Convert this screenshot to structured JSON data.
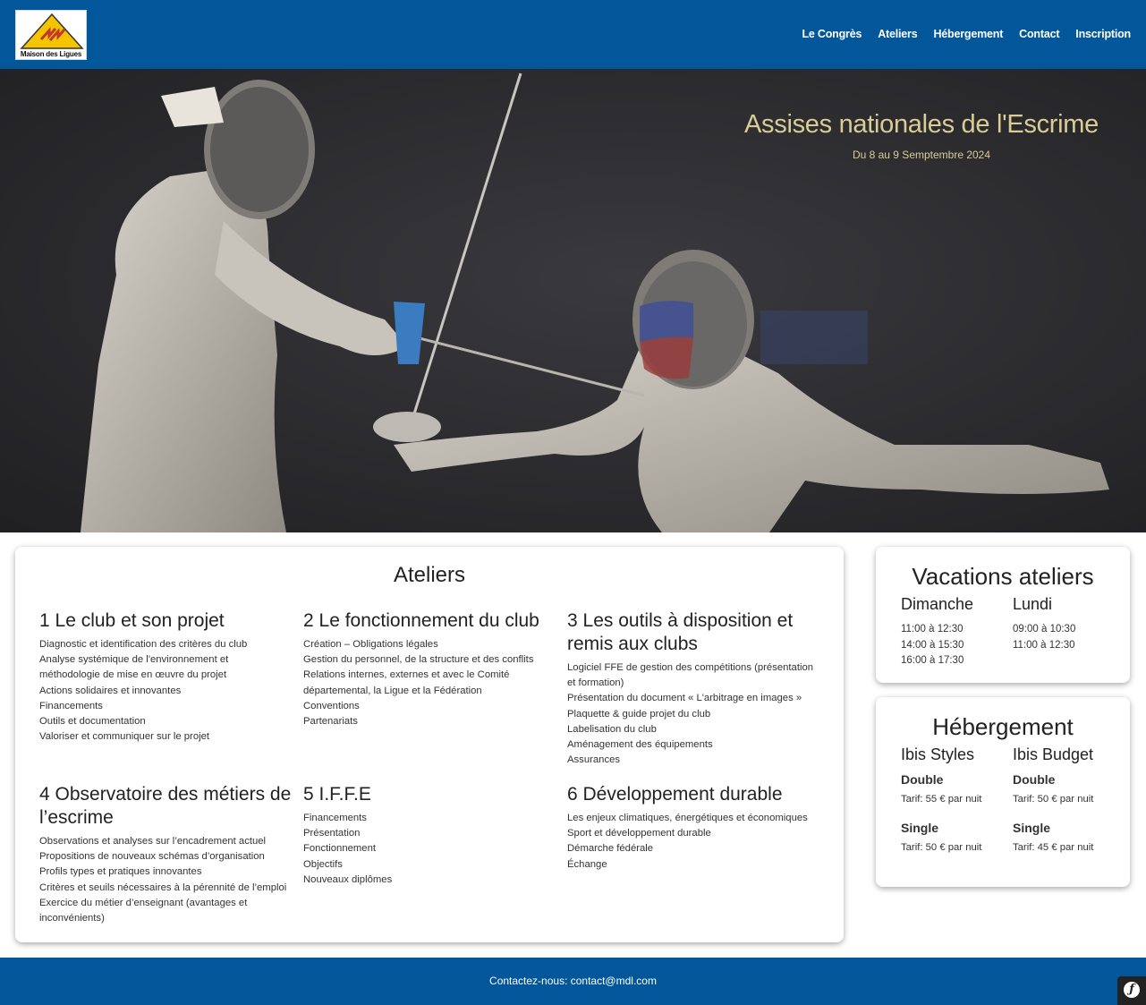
{
  "header": {
    "logo_text": "Maison des Ligues",
    "nav": [
      "Le Congrès",
      "Ateliers",
      "Hébergement",
      "Contact",
      "Inscription"
    ]
  },
  "hero": {
    "title": "Assises nationales de l'Escrime",
    "subtitle": "Du 8 au 9 Semptembre 2024"
  },
  "ateliers": {
    "title": "Ateliers",
    "items": [
      {
        "title": "1 Le club et son projet",
        "lines": [
          "Diagnostic et identification des critères du club",
          "Analyse systémique de l'environnement et",
          "méthodologie de mise en œuvre du projet",
          "Actions solidaires et innovantes",
          "Financements",
          "Outils et documentation",
          "Valoriser et communiquer sur le projet"
        ]
      },
      {
        "title": "2 Le fonctionnement du club",
        "lines": [
          "Création – Obligations légales",
          "Gestion du personnel, de la structure et des conflits",
          "Relations internes, externes et avec le Comité",
          "départemental, la Ligue et la Fédération",
          "Conventions",
          "Partenariats"
        ]
      },
      {
        "title": "3 Les outils à disposition et remis aux clubs",
        "lines": [
          "Logiciel FFE de gestion des compétitions (présentation",
          "et formation)",
          "Présentation du document « L'arbitrage en images »",
          "Plaquette & guide projet du club",
          "Labelisation du club",
          "Aménagement des équipements",
          "Assurances"
        ]
      },
      {
        "title": "4 Observatoire des métiers de l’escrime",
        "lines": [
          "Observations et analyses sur l’encadrement actuel",
          "Propositions de nouveaux schémas d’organisation",
          "Profils types et pratiques innovantes",
          "Critères et seuils nécessaires à la pérennité de l’emploi",
          "Exercice du métier d’enseignant (avantages et",
          "inconvénients)"
        ]
      },
      {
        "title": "5 I.F.F.E",
        "lines": [
          "Financements",
          "Présentation",
          "Fonctionnement",
          "Objectifs",
          "Nouveaux diplômes"
        ]
      },
      {
        "title": "6 Développement durable",
        "lines": [
          "Les enjeux climatiques, énergétiques et économiques",
          "Sport et développement durable",
          "Démarche fédérale",
          "Échange"
        ]
      }
    ]
  },
  "vacations": {
    "title": "Vacations ateliers",
    "days": [
      {
        "name": "Dimanche",
        "slots": [
          "11:00 à 12:30",
          "14:00 à 15:30",
          "16:00 à 17:30"
        ]
      },
      {
        "name": "Lundi",
        "slots": [
          "09:00 à 10:30",
          "11:00 à 12:30"
        ]
      }
    ]
  },
  "hebergement": {
    "title": "Hébergement",
    "hotels": [
      {
        "name": "Ibis Styles",
        "rooms": [
          {
            "type": "Double",
            "tarif": "Tarif: 55 € par nuit"
          },
          {
            "type": "Single",
            "tarif": "Tarif: 50 € par nuit"
          }
        ]
      },
      {
        "name": "Ibis Budget",
        "rooms": [
          {
            "type": "Double",
            "tarif": "Tarif: 50 € par nuit"
          },
          {
            "type": "Single",
            "tarif": "Tarif: 45 € par nuit"
          }
        ]
      }
    ]
  },
  "footer": {
    "text": "Contactez-nous: contact@mdl.com"
  },
  "colors": {
    "brand": "#02579a",
    "hero_text": "#d9cc95"
  },
  "icons": {
    "debug_toolbar": "symfony-icon"
  }
}
